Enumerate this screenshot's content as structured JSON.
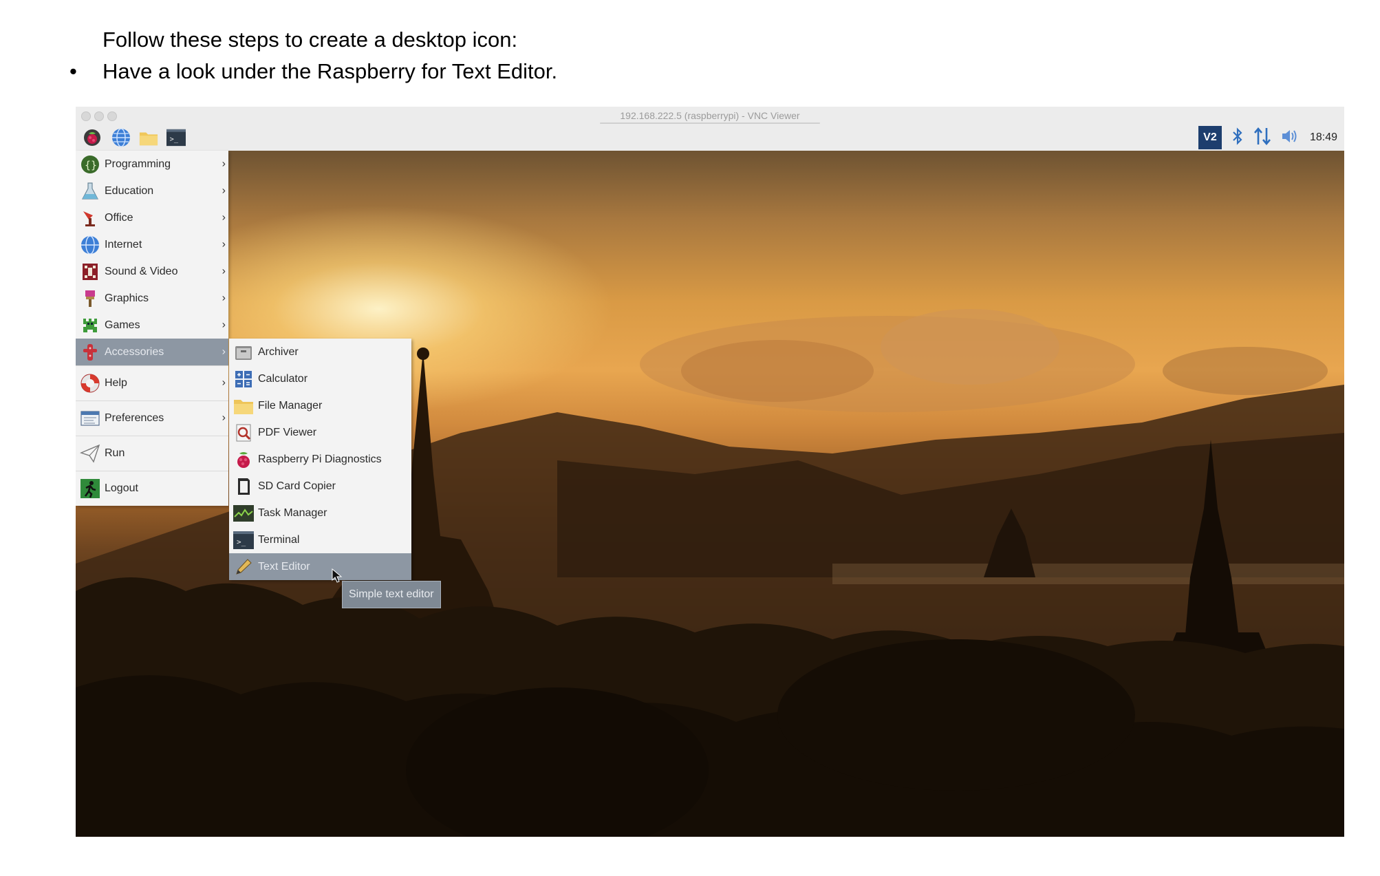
{
  "document": {
    "line1": "Follow these steps to create a desktop icon:",
    "bullet": "•",
    "line2": "Have a look under the Raspberry for Text Editor."
  },
  "window": {
    "title": "192.168.222.5 (raspberrypi) - VNC Viewer"
  },
  "panel": {
    "launchers": [
      "raspberry-menu-icon",
      "web-browser-icon",
      "file-manager-icon",
      "terminal-icon"
    ],
    "tray": [
      "vnc-icon",
      "bluetooth-icon",
      "network-icon",
      "volume-icon"
    ],
    "vnc_label": "V2",
    "clock": "18:49"
  },
  "menu": {
    "items": [
      {
        "label": "Programming",
        "icon": "programming-icon"
      },
      {
        "label": "Education",
        "icon": "education-icon"
      },
      {
        "label": "Office",
        "icon": "office-icon"
      },
      {
        "label": "Internet",
        "icon": "internet-icon"
      },
      {
        "label": "Sound & Video",
        "icon": "sound-video-icon"
      },
      {
        "label": "Graphics",
        "icon": "graphics-icon"
      },
      {
        "label": "Games",
        "icon": "games-icon"
      },
      {
        "label": "Accessories",
        "icon": "accessories-icon",
        "selected": true
      },
      {
        "label": "Help",
        "icon": "help-icon"
      },
      {
        "label": "Preferences",
        "icon": "preferences-icon"
      },
      {
        "label": "Run",
        "icon": "run-icon"
      },
      {
        "label": "Logout",
        "icon": "logout-icon"
      }
    ],
    "arrow": "›"
  },
  "submenu": {
    "items": [
      {
        "label": "Archiver",
        "icon": "archiver-icon"
      },
      {
        "label": "Calculator",
        "icon": "calculator-icon"
      },
      {
        "label": "File Manager",
        "icon": "folder-icon"
      },
      {
        "label": "PDF Viewer",
        "icon": "pdf-viewer-icon"
      },
      {
        "label": "Raspberry Pi Diagnostics",
        "icon": "raspberry-icon"
      },
      {
        "label": "SD Card Copier",
        "icon": "sd-card-icon"
      },
      {
        "label": "Task Manager",
        "icon": "task-manager-icon"
      },
      {
        "label": "Terminal",
        "icon": "terminal-icon"
      },
      {
        "label": "Text Editor",
        "icon": "pencil-icon",
        "selected": true
      }
    ]
  },
  "tooltip": "Simple text editor",
  "colors": {
    "menu_bg": "#f3f3f3",
    "selected_bg": "#8d97a3",
    "panel_bg": "#ececec"
  }
}
